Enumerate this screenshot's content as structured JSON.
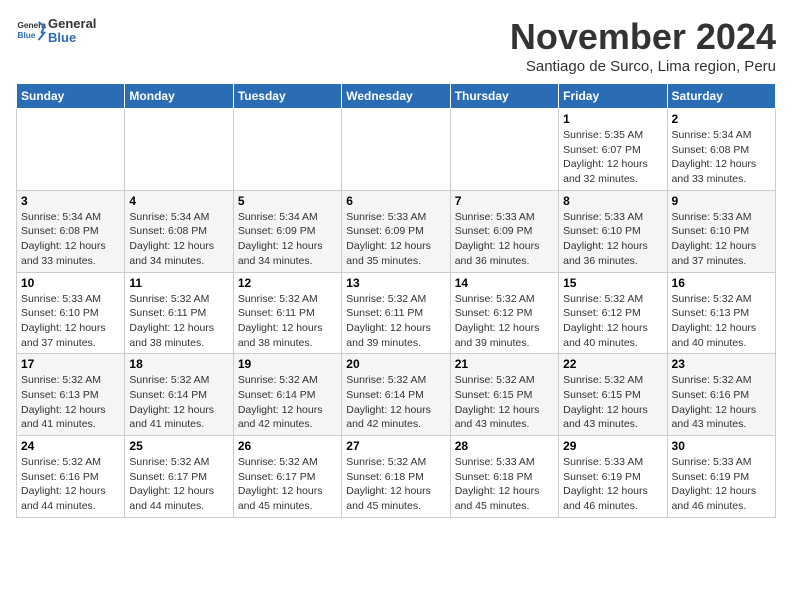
{
  "header": {
    "logo_general": "General",
    "logo_blue": "Blue",
    "month_title": "November 2024",
    "subtitle": "Santiago de Surco, Lima region, Peru"
  },
  "calendar": {
    "days_of_week": [
      "Sunday",
      "Monday",
      "Tuesday",
      "Wednesday",
      "Thursday",
      "Friday",
      "Saturday"
    ],
    "weeks": [
      [
        {
          "day": "",
          "info": ""
        },
        {
          "day": "",
          "info": ""
        },
        {
          "day": "",
          "info": ""
        },
        {
          "day": "",
          "info": ""
        },
        {
          "day": "",
          "info": ""
        },
        {
          "day": "1",
          "info": "Sunrise: 5:35 AM\nSunset: 6:07 PM\nDaylight: 12 hours and 32 minutes."
        },
        {
          "day": "2",
          "info": "Sunrise: 5:34 AM\nSunset: 6:08 PM\nDaylight: 12 hours and 33 minutes."
        }
      ],
      [
        {
          "day": "3",
          "info": "Sunrise: 5:34 AM\nSunset: 6:08 PM\nDaylight: 12 hours and 33 minutes."
        },
        {
          "day": "4",
          "info": "Sunrise: 5:34 AM\nSunset: 6:08 PM\nDaylight: 12 hours and 34 minutes."
        },
        {
          "day": "5",
          "info": "Sunrise: 5:34 AM\nSunset: 6:09 PM\nDaylight: 12 hours and 34 minutes."
        },
        {
          "day": "6",
          "info": "Sunrise: 5:33 AM\nSunset: 6:09 PM\nDaylight: 12 hours and 35 minutes."
        },
        {
          "day": "7",
          "info": "Sunrise: 5:33 AM\nSunset: 6:09 PM\nDaylight: 12 hours and 36 minutes."
        },
        {
          "day": "8",
          "info": "Sunrise: 5:33 AM\nSunset: 6:10 PM\nDaylight: 12 hours and 36 minutes."
        },
        {
          "day": "9",
          "info": "Sunrise: 5:33 AM\nSunset: 6:10 PM\nDaylight: 12 hours and 37 minutes."
        }
      ],
      [
        {
          "day": "10",
          "info": "Sunrise: 5:33 AM\nSunset: 6:10 PM\nDaylight: 12 hours and 37 minutes."
        },
        {
          "day": "11",
          "info": "Sunrise: 5:32 AM\nSunset: 6:11 PM\nDaylight: 12 hours and 38 minutes."
        },
        {
          "day": "12",
          "info": "Sunrise: 5:32 AM\nSunset: 6:11 PM\nDaylight: 12 hours and 38 minutes."
        },
        {
          "day": "13",
          "info": "Sunrise: 5:32 AM\nSunset: 6:11 PM\nDaylight: 12 hours and 39 minutes."
        },
        {
          "day": "14",
          "info": "Sunrise: 5:32 AM\nSunset: 6:12 PM\nDaylight: 12 hours and 39 minutes."
        },
        {
          "day": "15",
          "info": "Sunrise: 5:32 AM\nSunset: 6:12 PM\nDaylight: 12 hours and 40 minutes."
        },
        {
          "day": "16",
          "info": "Sunrise: 5:32 AM\nSunset: 6:13 PM\nDaylight: 12 hours and 40 minutes."
        }
      ],
      [
        {
          "day": "17",
          "info": "Sunrise: 5:32 AM\nSunset: 6:13 PM\nDaylight: 12 hours and 41 minutes."
        },
        {
          "day": "18",
          "info": "Sunrise: 5:32 AM\nSunset: 6:14 PM\nDaylight: 12 hours and 41 minutes."
        },
        {
          "day": "19",
          "info": "Sunrise: 5:32 AM\nSunset: 6:14 PM\nDaylight: 12 hours and 42 minutes."
        },
        {
          "day": "20",
          "info": "Sunrise: 5:32 AM\nSunset: 6:14 PM\nDaylight: 12 hours and 42 minutes."
        },
        {
          "day": "21",
          "info": "Sunrise: 5:32 AM\nSunset: 6:15 PM\nDaylight: 12 hours and 43 minutes."
        },
        {
          "day": "22",
          "info": "Sunrise: 5:32 AM\nSunset: 6:15 PM\nDaylight: 12 hours and 43 minutes."
        },
        {
          "day": "23",
          "info": "Sunrise: 5:32 AM\nSunset: 6:16 PM\nDaylight: 12 hours and 43 minutes."
        }
      ],
      [
        {
          "day": "24",
          "info": "Sunrise: 5:32 AM\nSunset: 6:16 PM\nDaylight: 12 hours and 44 minutes."
        },
        {
          "day": "25",
          "info": "Sunrise: 5:32 AM\nSunset: 6:17 PM\nDaylight: 12 hours and 44 minutes."
        },
        {
          "day": "26",
          "info": "Sunrise: 5:32 AM\nSunset: 6:17 PM\nDaylight: 12 hours and 45 minutes."
        },
        {
          "day": "27",
          "info": "Sunrise: 5:32 AM\nSunset: 6:18 PM\nDaylight: 12 hours and 45 minutes."
        },
        {
          "day": "28",
          "info": "Sunrise: 5:33 AM\nSunset: 6:18 PM\nDaylight: 12 hours and 45 minutes."
        },
        {
          "day": "29",
          "info": "Sunrise: 5:33 AM\nSunset: 6:19 PM\nDaylight: 12 hours and 46 minutes."
        },
        {
          "day": "30",
          "info": "Sunrise: 5:33 AM\nSunset: 6:19 PM\nDaylight: 12 hours and 46 minutes."
        }
      ]
    ]
  }
}
